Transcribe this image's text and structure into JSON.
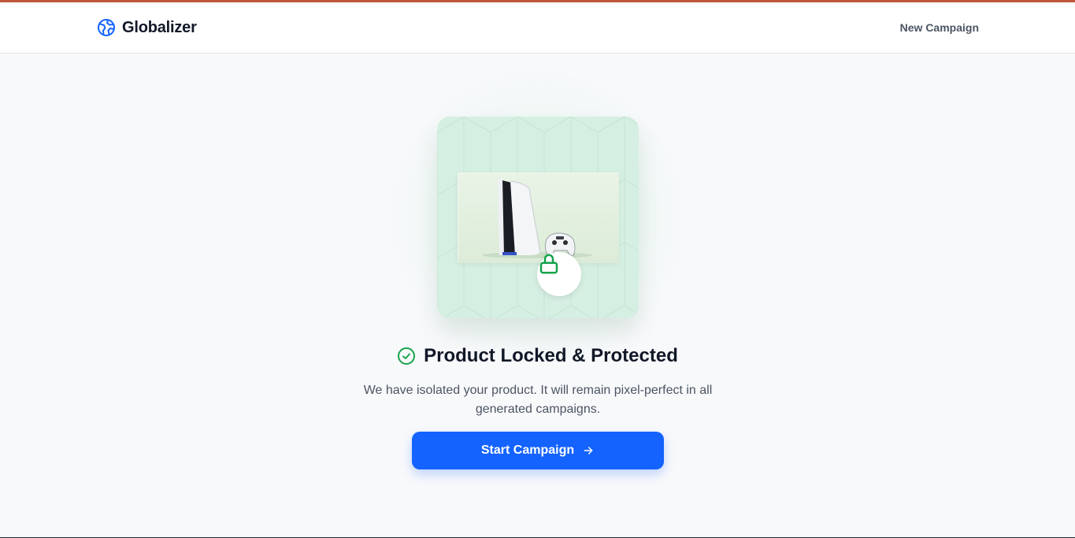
{
  "header": {
    "brand_name": "Globalizer",
    "brand_icon": "globe-icon",
    "nav_link": "New Campaign"
  },
  "main": {
    "title": "Product Locked & Protected",
    "description": "We have isolated your product. It will remain pixel-perfect in all generated campaigns.",
    "cta_label": "Start Campaign",
    "icons": {
      "status": "check-circle-icon",
      "lock": "lock-icon",
      "cta": "arrow-right-icon"
    }
  },
  "colors": {
    "accent": "#1463ff",
    "success": "#16a34a",
    "card_bg": "#d6efe3",
    "top_strip": "#c0573a"
  }
}
